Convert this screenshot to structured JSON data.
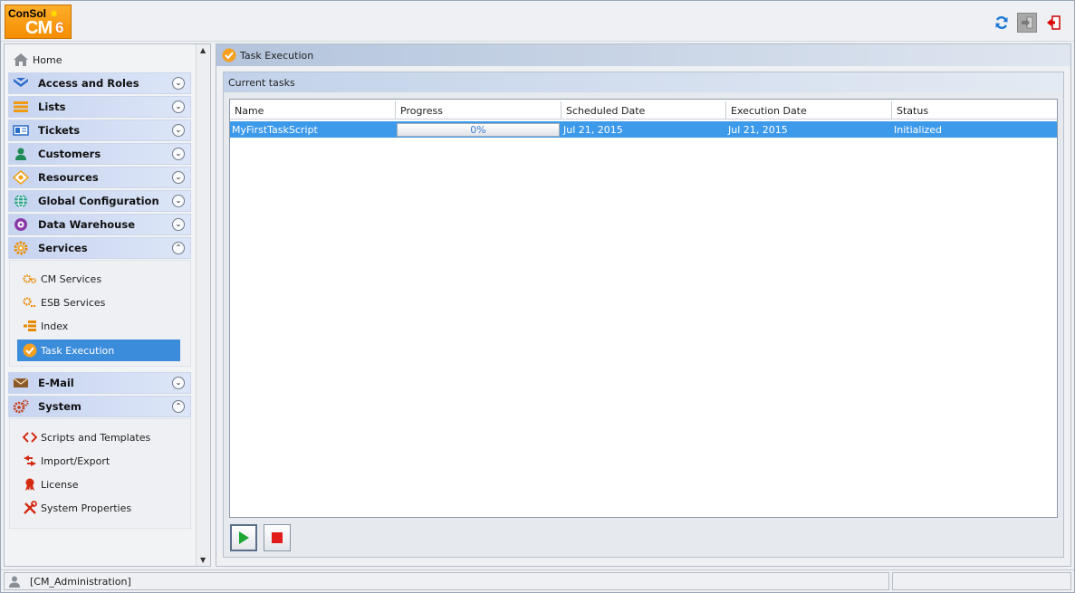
{
  "header": {
    "logo_line1": "ConSol",
    "logo_line2": "CM",
    "logo_line3": "6"
  },
  "sidebar": {
    "home": "Home",
    "sections": [
      {
        "label": "Access and Roles",
        "icon": "access-roles-icon",
        "expanded": false
      },
      {
        "label": "Lists",
        "icon": "lists-icon",
        "expanded": false
      },
      {
        "label": "Tickets",
        "icon": "tickets-icon",
        "expanded": false
      },
      {
        "label": "Customers",
        "icon": "customers-icon",
        "expanded": false
      },
      {
        "label": "Resources",
        "icon": "resources-icon",
        "expanded": false
      },
      {
        "label": "Global Configuration",
        "icon": "globe-icon",
        "expanded": false
      },
      {
        "label": "Data Warehouse",
        "icon": "data-warehouse-icon",
        "expanded": false
      },
      {
        "label": "Services",
        "icon": "services-gear-icon",
        "expanded": true
      },
      {
        "label": "E-Mail",
        "icon": "email-icon",
        "expanded": false
      },
      {
        "label": "System",
        "icon": "system-gears-icon",
        "expanded": true
      }
    ],
    "services_items": [
      {
        "label": "CM Services",
        "icon": "cm-services-icon",
        "selected": false
      },
      {
        "label": "ESB Services",
        "icon": "esb-services-icon",
        "selected": false
      },
      {
        "label": "Index",
        "icon": "index-icon",
        "selected": false
      },
      {
        "label": "Task Execution",
        "icon": "task-execution-icon",
        "selected": true
      }
    ],
    "system_items": [
      {
        "label": "Scripts and Templates",
        "icon": "code-icon"
      },
      {
        "label": "Import/Export",
        "icon": "import-export-icon"
      },
      {
        "label": "License",
        "icon": "license-icon"
      },
      {
        "label": "System Properties",
        "icon": "tools-icon"
      }
    ]
  },
  "main": {
    "title": "Task Execution",
    "panel_title": "Current tasks",
    "columns": [
      "Name",
      "Progress",
      "Scheduled Date",
      "Execution Date",
      "Status"
    ],
    "rows": [
      {
        "name": "MyFirstTaskScript",
        "progress": "0%",
        "progress_value": 0,
        "scheduled": "Jul 21, 2015",
        "execution": "Jul 21, 2015",
        "status": "Initialized"
      }
    ]
  },
  "statusbar": {
    "user": "[CM_Administration]"
  },
  "colors": {
    "selection": "#3d9aeb",
    "accent_orange": "#f5a021",
    "start_green": "#1aa832",
    "stop_red": "#e21b1b"
  }
}
